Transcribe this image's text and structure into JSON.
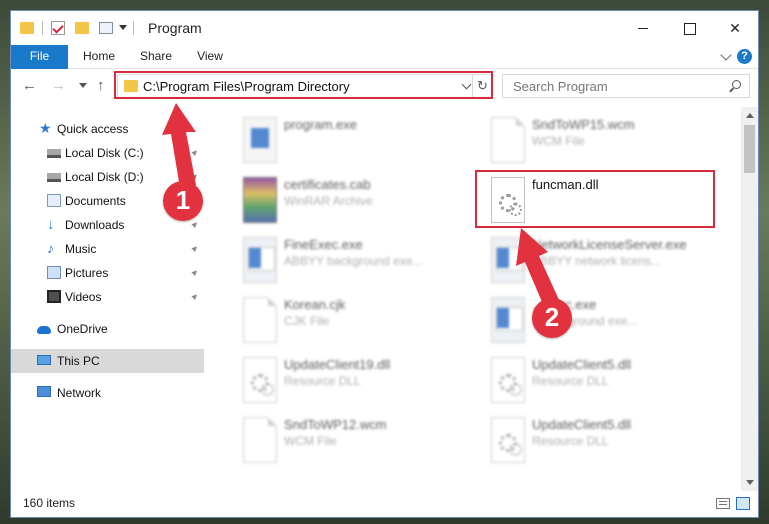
{
  "window": {
    "title": "Program",
    "minimize": "–",
    "maximize": "□",
    "close": "✕"
  },
  "ribbon": {
    "tabs": [
      "File",
      "Home",
      "Share",
      "View"
    ],
    "help": "?"
  },
  "nav": {
    "back": "←",
    "forward": "→",
    "up": "↑",
    "address": "C:\\Program Files\\Program Directory",
    "refresh": "↻",
    "search_placeholder": "Search Program"
  },
  "sidebar": {
    "items": [
      {
        "label": "Quick access",
        "icon": "star-icon"
      },
      {
        "label": "Local Disk (C:)",
        "icon": "disk-icon",
        "pinned": true
      },
      {
        "label": "Local Disk (D:)",
        "icon": "disk-icon",
        "pinned": true
      },
      {
        "label": "Documents",
        "icon": "documents-icon",
        "pinned": true
      },
      {
        "label": "Downloads",
        "icon": "download-icon",
        "pinned": true
      },
      {
        "label": "Music",
        "icon": "music-icon",
        "pinned": true
      },
      {
        "label": "Pictures",
        "icon": "pictures-icon",
        "pinned": true
      },
      {
        "label": "Videos",
        "icon": "videos-icon",
        "pinned": true
      },
      {
        "label": "OneDrive",
        "icon": "cloud-icon"
      },
      {
        "label": "This PC",
        "icon": "computer-icon",
        "selected": true
      },
      {
        "label": "Network",
        "icon": "network-icon"
      }
    ]
  },
  "files": [
    {
      "name": "program.exe",
      "type": "",
      "icon": "exe-icon"
    },
    {
      "name": "SndToWP15.wcm",
      "type": "WCM File",
      "icon": "document-icon"
    },
    {
      "name": "certificates.cab",
      "type": "WinRAR Archive",
      "icon": "archive-icon"
    },
    {
      "name": "funcman.dll",
      "type": "",
      "icon": "dll-icon"
    },
    {
      "name": "FineExec.exe",
      "type": "ABBYY background exe...",
      "icon": "application-icon"
    },
    {
      "name": "NetworkLicenseServer.exe",
      "type": "ABBYY network licens...",
      "icon": "application-icon"
    },
    {
      "name": "Korean.cjk",
      "type": "CJK File",
      "icon": "document-icon"
    },
    {
      "name": "...Exec.exe",
      "type": "...background exe...",
      "icon": "application-icon"
    },
    {
      "name": "UpdateClient19.dll",
      "type": "Resource DLL",
      "icon": "dll-icon"
    },
    {
      "name": "UpdateClient5.dll",
      "type": "Resource DLL",
      "icon": "dll-icon"
    },
    {
      "name": "SndToWP12.wcm",
      "type": "WCM File",
      "icon": "document-icon"
    },
    {
      "name": "UpdateClient5.dll",
      "type": "Resource DLL",
      "icon": "dll-icon"
    }
  ],
  "status": {
    "item_count": "160 items"
  },
  "annotations": {
    "step1": "1",
    "step2": "2",
    "highlight_color": "#d72b3b",
    "badge_color": "#e2323f"
  },
  "colors": {
    "accent": "#1979ca",
    "folder": "#f3c649"
  }
}
